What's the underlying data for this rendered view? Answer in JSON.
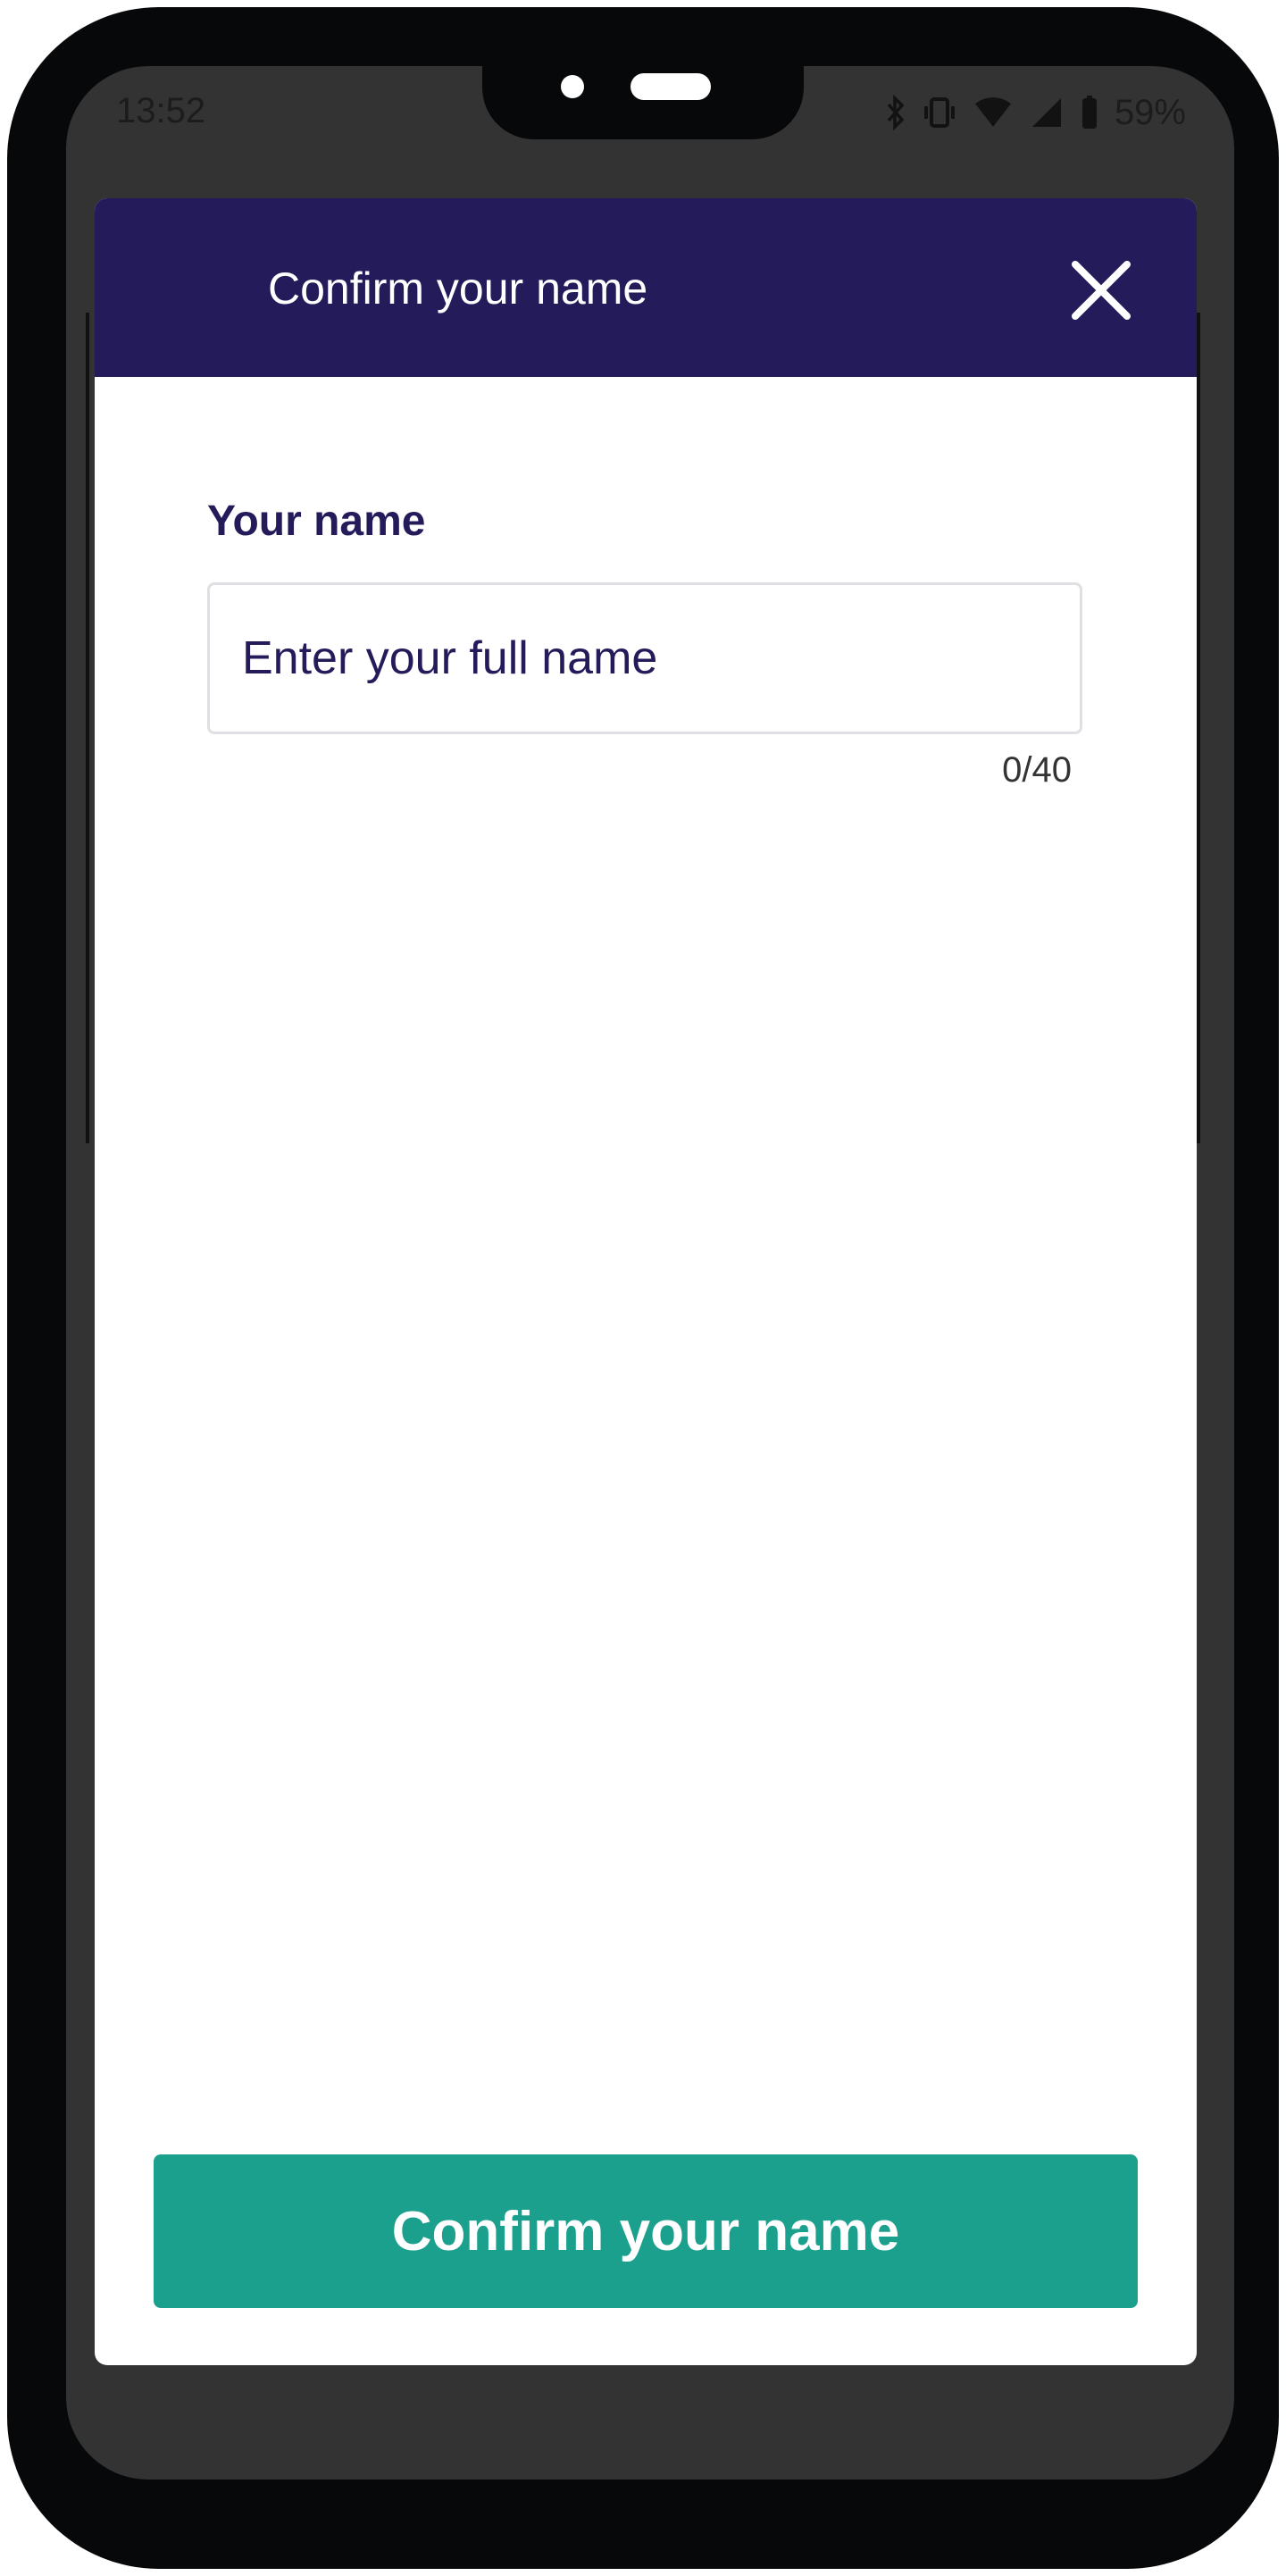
{
  "status_bar": {
    "time": "13:52",
    "battery_percent": "59%",
    "icons": [
      "bluetooth-icon",
      "vibrate-icon",
      "wifi-icon",
      "signal-icon",
      "battery-icon"
    ]
  },
  "dialog": {
    "title": "Confirm your name",
    "close_icon": "close-icon"
  },
  "form": {
    "label": "Your name",
    "input_value": "",
    "placeholder": "Enter your full name",
    "char_count": "0/40"
  },
  "actions": {
    "confirm_label": "Confirm your name"
  },
  "colors": {
    "header_bg": "#241c5a",
    "accent_text": "#241c5a",
    "button_bg": "#1aa08c",
    "device_frame": "#070809",
    "screen_bg": "#333333"
  }
}
